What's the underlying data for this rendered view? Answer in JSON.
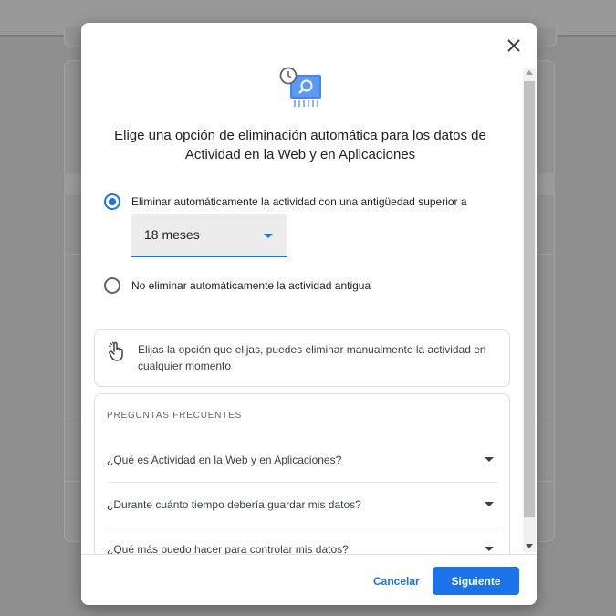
{
  "dialog": {
    "title": "Elige una opción de eliminación automática para los datos de Actividad en la Web y en Aplicaciones",
    "options": [
      {
        "label": "Eliminar automáticamente la actividad con una antigüedad superior a",
        "selected": true
      },
      {
        "label": "No eliminar automáticamente la actividad antigua",
        "selected": false
      }
    ],
    "duration_select": {
      "value": "18 meses"
    },
    "info_text": "Elijas la opción que elijas, puedes eliminar manualmente la actividad en cualquier momento",
    "faq": {
      "heading": "PREGUNTAS FRECUENTES",
      "items": [
        "¿Qué es Actividad en la Web y en Aplicaciones?",
        "¿Durante cuánto tiempo debería guardar mis datos?",
        "¿Qué más puedo hacer para controlar mis datos?"
      ]
    },
    "buttons": {
      "cancel": "Cancelar",
      "next": "Siguiente"
    }
  },
  "colors": {
    "accent": "#1a73e8",
    "overlay": "#8f8f8f",
    "dialog_bg": "#ffffff"
  },
  "icons": [
    "close-icon",
    "activity-clock-icon",
    "hand-pointer-icon",
    "chevron-down-icon"
  ]
}
